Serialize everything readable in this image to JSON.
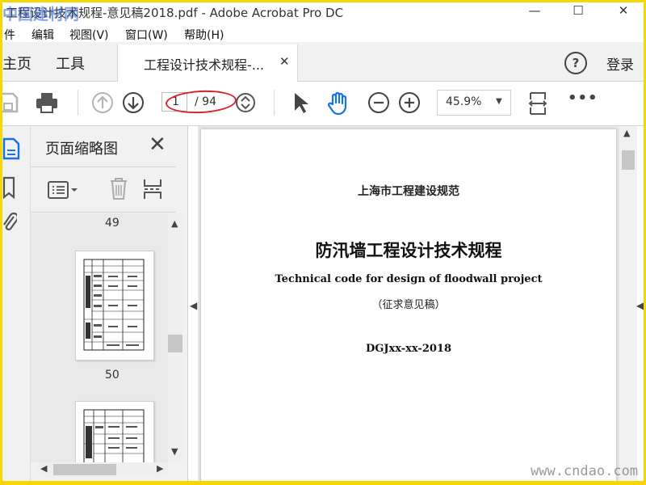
{
  "window": {
    "title": "工程设计技术规程-意见稿2018.pdf - Adobe Acrobat Pro DC",
    "controls": {
      "minimize": "—",
      "maximize": "☐",
      "close": "✕"
    }
  },
  "watermark": {
    "top_left": "中国建材网",
    "bottom_right": "www.cndao.com"
  },
  "menu": {
    "items": [
      "件",
      "编辑",
      "视图(V)",
      "窗口(W)",
      "帮助(H)"
    ]
  },
  "tabs": {
    "home": "主页",
    "tools": "工具",
    "document": "工程设计技术规程-...",
    "close": "✕"
  },
  "header_right": {
    "help": "?",
    "login": "登录"
  },
  "toolbar": {
    "page_current": "1",
    "page_total": "/ 94",
    "zoom": "45.9%",
    "more": "•••"
  },
  "panel": {
    "title": "页面缩略图",
    "close": "✕",
    "thumbnails": [
      {
        "label": "49"
      },
      {
        "label": "50"
      }
    ]
  },
  "document": {
    "org": "上海市工程建设规范",
    "title": "防汛墙工程设计技术规程",
    "title_en": "Technical code for design of floodwall project",
    "subtitle": "（征求意见稿）",
    "code": "DGJxx-xx-2018"
  },
  "colors": {
    "frame_border": "#f4d800",
    "annotation_ellipse": "#d8242b",
    "hand_tool_active": "#1473e6"
  }
}
